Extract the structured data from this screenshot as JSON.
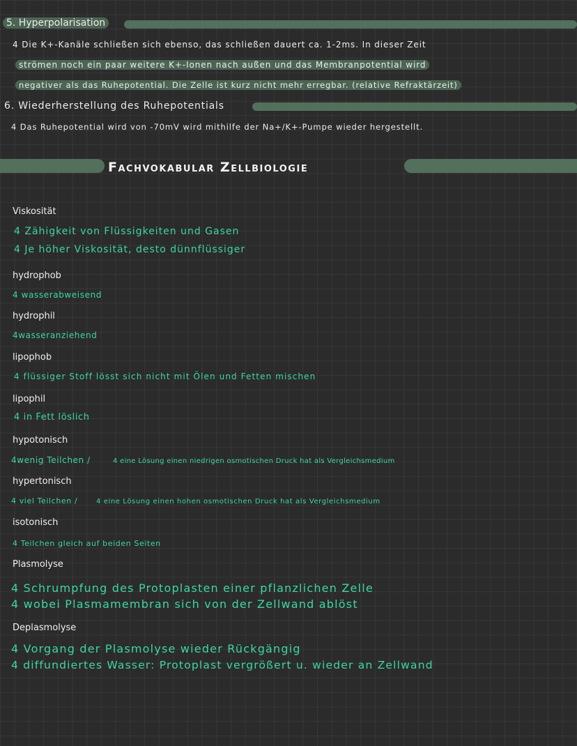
{
  "section5": {
    "heading": "5. Hyperpolarisation",
    "lines": [
      "4 Die K+-Kanäle schließen sich ebenso, das schließen dauert ca. 1-2ms. In dieser Zeit",
      "strömen noch ein paar weitere K+-Ionen nach außen und das Membranpotential wird",
      "negativer als das Ruhepotential. Die Zelle ist kurz nicht mehr erregbar. (relative Refraktärzeit)"
    ]
  },
  "section6": {
    "heading": "6. Wiederherstellung des Ruhepotentials",
    "line": "4 Das Ruhepotential wird von -70mV wird mithilfe der Na+/K+-Pumpe wieder hergestellt."
  },
  "vocab_heading": "Fachvokabular Zellbiologie",
  "entries": [
    {
      "term": "Viskosität",
      "defs": [
        "4 Zähigkeit von Flüssigkeiten und Gasen",
        "4 Je höher Viskosität, desto dünnflüssiger"
      ]
    },
    {
      "term": "hydrophob",
      "defs": [
        "4 wasserabweisend"
      ]
    },
    {
      "term": "hydrophil",
      "defs": [
        "4wasseranziehend"
      ]
    },
    {
      "term": "lipophob",
      "defs": [
        "4 flüssiger Stoff lösst sich nicht mit Ölen und Fetten mischen"
      ]
    },
    {
      "term": "lipophil",
      "defs": [
        "4 in Fett löslich"
      ]
    },
    {
      "term": "hypotonisch",
      "defs": [
        "4wenig Teilchen /",
        "4 eine Lösung einen niedrigen osmotischen Druck hat als Vergleichsmedium"
      ]
    },
    {
      "term": "hypertonisch",
      "defs": [
        "4 viel Teilchen /",
        "4 eine Lösung einen hohen osmotischen Druck hat als Vergleichsmedium"
      ]
    },
    {
      "term": "isotonisch",
      "defs": [
        "4 Teilchen gleich auf beiden Seiten"
      ]
    },
    {
      "term": "Plasmolyse",
      "defs": [
        "4 Schrumpfung des Protoplasten einer pflanzlichen Zelle",
        "4 wobei Plasmamembran sich von der Zellwand ablöst"
      ]
    },
    {
      "term": "Deplasmolyse",
      "defs": [
        "4 Vorgang der Plasmolyse wieder Rückgängig",
        "4 diffundiertes Wasser: Protoplast vergrößert u. wieder an Zellwand"
      ]
    }
  ],
  "colors": {
    "background": "#2b2b2c",
    "highlight": "#52705b",
    "definition": "#3ed79c"
  }
}
